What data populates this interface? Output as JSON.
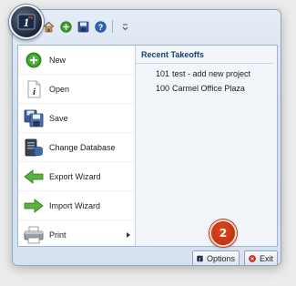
{
  "quick_access": [
    {
      "icon": "home-icon"
    },
    {
      "icon": "add-icon"
    },
    {
      "icon": "save-icon"
    },
    {
      "icon": "help-icon"
    },
    {
      "icon": "customize-icon"
    }
  ],
  "menu": {
    "items": [
      {
        "label": "New",
        "icon": "new-plus-icon"
      },
      {
        "label": "Open",
        "icon": "open-info-icon"
      },
      {
        "label": "Save",
        "icon": "save-disk-icon"
      },
      {
        "label": "Change Database",
        "icon": "database-icon"
      },
      {
        "label": "Export Wizard",
        "icon": "export-arrow-icon"
      },
      {
        "label": "Import Wizard",
        "icon": "import-arrow-icon"
      },
      {
        "label": "Print",
        "icon": "printer-icon",
        "has_submenu": true
      }
    ]
  },
  "recent": {
    "header": "Recent Takeoffs",
    "items": [
      {
        "number": "101",
        "name": "test - add new project"
      },
      {
        "number": "100",
        "name": "Carmel Office Plaza"
      }
    ]
  },
  "footer": {
    "options_label": "Options",
    "exit_label": "Exit"
  },
  "callout": {
    "label": "2"
  },
  "colors": {
    "accent": "#15406e",
    "callout": "#c9350f",
    "exit_red": "#d22a1e",
    "new_green": "#3a9a2a"
  }
}
